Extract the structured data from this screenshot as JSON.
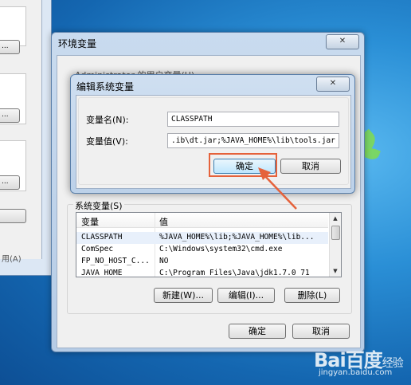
{
  "back_window": {
    "apply_label": "用(A)"
  },
  "env_window": {
    "title": "环境变量",
    "hidden_label": "Administrator 的用户变量(U)",
    "system_vars_label": "系统变量(S)",
    "columns": [
      "变量",
      "值"
    ],
    "rows": [
      {
        "name": "CLASSPATH",
        "value": "%JAVA_HOME%\\lib;%JAVA_HOME%\\lib..."
      },
      {
        "name": "ComSpec",
        "value": "C:\\Windows\\system32\\cmd.exe"
      },
      {
        "name": "FP_NO_HOST_C...",
        "value": "NO"
      },
      {
        "name": "JAVA_HOME",
        "value": "C:\\Program Files\\Java\\jdk1.7.0_71"
      }
    ],
    "buttons": {
      "new": "新建(W)...",
      "edit": "编辑(I)...",
      "delete": "删除(L)"
    },
    "ok": "确定",
    "cancel": "取消"
  },
  "edit_dialog": {
    "title": "编辑系统变量",
    "name_label": "变量名(N):",
    "value_label": "变量值(V):",
    "name_value": "CLASSPATH",
    "value_value": ".ib\\dt.jar;%JAVA_HOME%\\lib\\tools.jar",
    "ok": "确定",
    "cancel": "取消"
  },
  "watermark": {
    "logo": "Bai百度",
    "sub": "经验",
    "url": "jingyan.baidu.com"
  },
  "colors": {
    "highlight": "#e5623b",
    "desktop": "#1f7fc9"
  }
}
